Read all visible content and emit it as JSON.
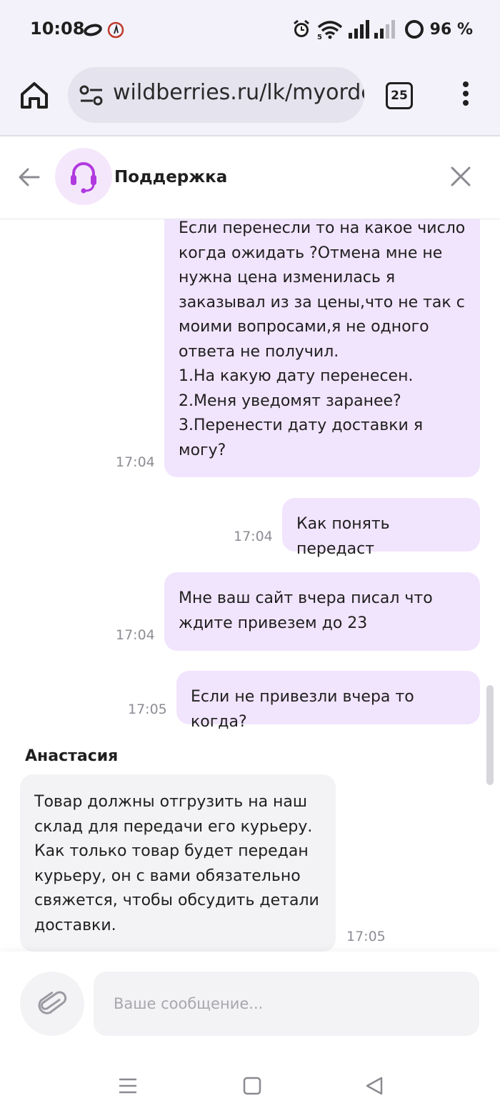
{
  "status": {
    "time": "10:08",
    "battery": "96 %",
    "icons": [
      "infinity-icon",
      "alarm-clock-icon",
      "wifi-icon",
      "signal-icon",
      "battery-icon"
    ]
  },
  "browser": {
    "url": "wildberries.ru/lk/myorders",
    "tab_count": "25"
  },
  "header": {
    "title": "Поддержка"
  },
  "messages": [
    {
      "side": "out",
      "lines": [
        "Если перенесли то на какое число",
        "когда ожидать ?Отмена мне не",
        "нужна цена изменилась я",
        "заказывал из за цены,что не так с",
        "моими вопросами,я не одного",
        "ответа не получил.",
        "1.На какую дату перенесен.",
        "2.Меня уведомят заранее?",
        "3.Перенести дату доставки я",
        "могу?"
      ],
      "time": "17:04"
    },
    {
      "side": "out",
      "lines": [
        "Как понять передаст"
      ],
      "time": "17:04"
    },
    {
      "side": "out",
      "lines": [
        "Мне ваш сайт вчера писал что",
        "ждите привезем до 23"
      ],
      "time": "17:04"
    },
    {
      "side": "out",
      "lines": [
        "Если не привезли вчера то когда?"
      ],
      "time": "17:05"
    },
    {
      "side": "in",
      "sender": "Анастасия",
      "lines": [
        "Товар должны отгрузить на наш",
        "склад для передачи его курьеру.",
        "Как только товар будет передан",
        "курьеру, он с вами обязательно",
        "свяжется, чтобы обсудить детали",
        "доставки."
      ],
      "time": "17:05"
    }
  ],
  "composer": {
    "placeholder": "Ваше сообщение..."
  },
  "colors": {
    "accent": "#b03adf",
    "outgoing_bubble": "#f1e4fd",
    "incoming_bubble": "#f3f3f5"
  }
}
